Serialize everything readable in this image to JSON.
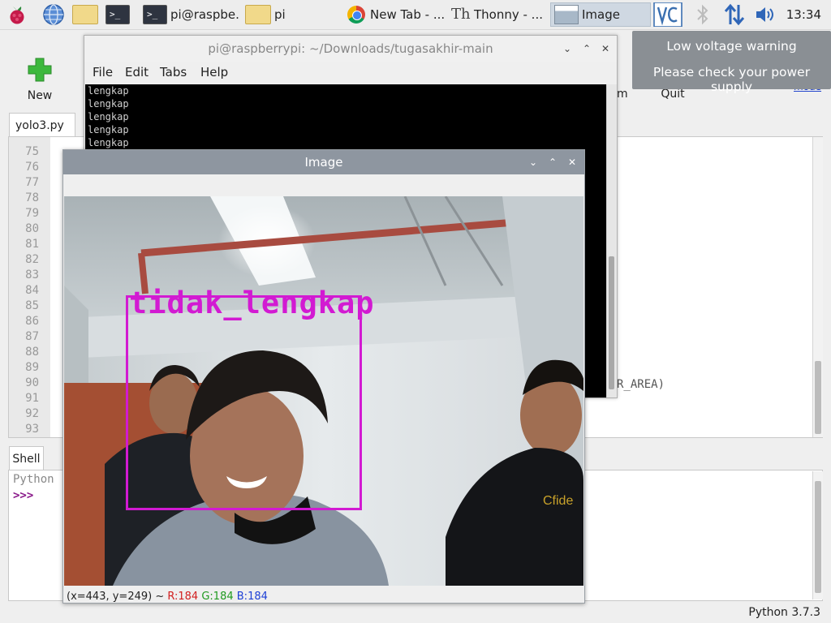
{
  "taskbar": {
    "tasks": [
      {
        "label": "pi@raspbe..."
      },
      {
        "label": "pi"
      },
      {
        "label": "New Tab - ..."
      },
      {
        "label": "Thonny  -  ..."
      },
      {
        "label": "Image"
      }
    ],
    "clock": "13:34",
    "term_glyph": ">_"
  },
  "notification": {
    "line1": "Low voltage warning",
    "line2": "Please check your power supply"
  },
  "thonny": {
    "tools": {
      "new": "New",
      "run_partial": "m",
      "quit": "Quit",
      "mode_partial": "mode"
    },
    "editor_tab": "yolo3.py",
    "editor_tab_close": "✕",
    "line_numbers": [
      "75",
      "76",
      "77",
      "78",
      "79",
      "80",
      "81",
      "82",
      "83",
      "84",
      "85",
      "86",
      "87",
      "88",
      "89",
      "90",
      "91",
      "92",
      "93"
    ],
    "code_fragment": "R_AREA)",
    "shell_tab": "Shell",
    "shell_banner": "Python",
    "shell_prompt": ">>>",
    "statusbar": "Python 3.7.3"
  },
  "terminal": {
    "title": "pi@raspberrypi: ~/Downloads/tugasakhir-main",
    "menu": [
      "File",
      "Edit",
      "Tabs",
      "Help"
    ],
    "lines": [
      "lengkap",
      "lengkap",
      "lengkap",
      "lengkap",
      "lengkap"
    ]
  },
  "image_window": {
    "title": "Image",
    "detection_label": "tidak_lengkap",
    "status_coords": "(x=443, y=249) ~",
    "status_r": "R:184",
    "status_g": "G:184",
    "status_b": "B:184"
  },
  "colors": {
    "detection_box": "#d21ad2",
    "status_r": "#d22020",
    "status_g": "#1f9a1f",
    "status_b": "#1c3fd6"
  }
}
